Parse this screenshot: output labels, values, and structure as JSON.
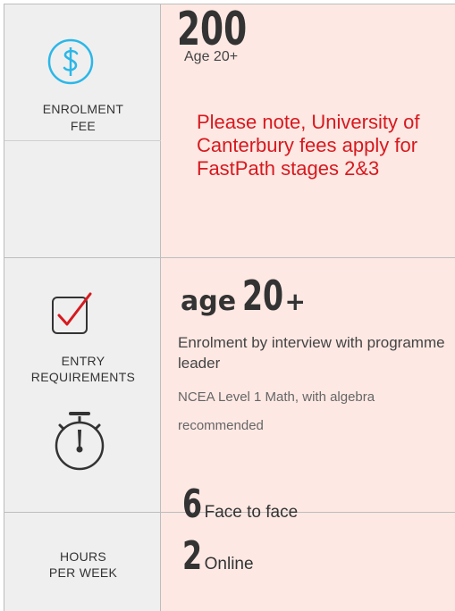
{
  "fee": {
    "label_line1": "ENROLMENT",
    "label_line2": "FEE",
    "icon": "dollar-circle-icon",
    "amount": "200",
    "age": "Age 20+",
    "note": "Please note, University of Canterbury fees apply for FastPath stages 2&3"
  },
  "entry": {
    "label_line1": "ENTRY",
    "label_line2": "REQUIREMENTS",
    "icon": "checkbox-icon",
    "age_word": "age",
    "age_number": "20",
    "age_plus": "+",
    "interview": "Enrolment by interview with programme leader",
    "ncea_line1": "NCEA Level 1 Math, with algebra",
    "ncea_line2": "recommended"
  },
  "hours": {
    "icon": "stopwatch-icon",
    "label_line1": "HOURS",
    "label_line2": "PER WEEK",
    "face_hours": "6",
    "face_label": "Face to face",
    "online_hours": "2",
    "online_label": "Online"
  },
  "colors": {
    "accent_red": "#d7191f",
    "row_pink": "#fde8e3",
    "label_gray": "#efefef"
  }
}
